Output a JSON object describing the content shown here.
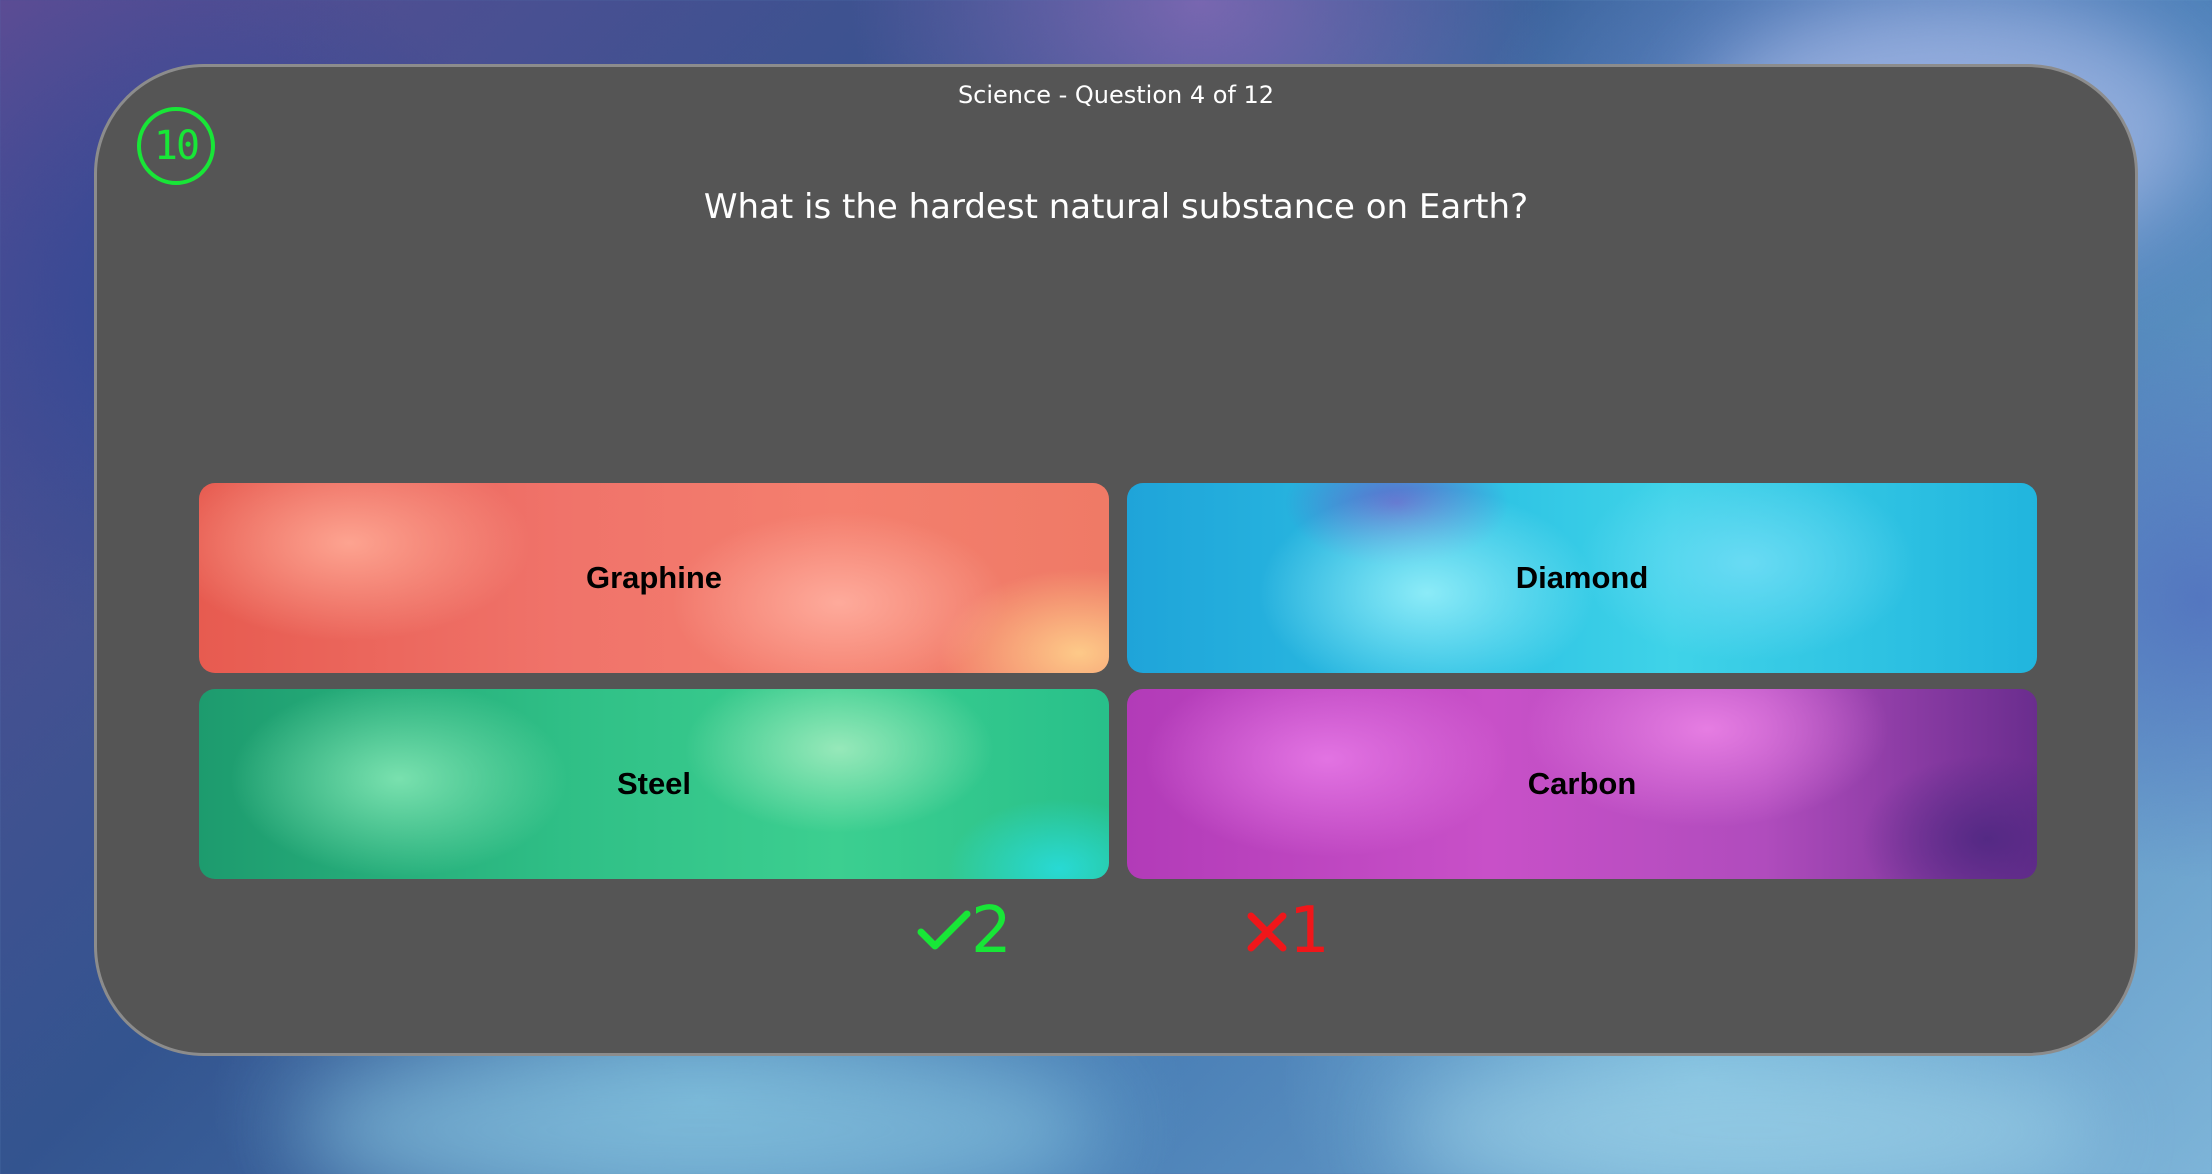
{
  "header": {
    "subtitle": "Science - Question 4 of 12"
  },
  "timer": {
    "value": "10",
    "color": "#18e637"
  },
  "question": {
    "text": "What is the hardest natural substance on Earth?"
  },
  "answers": [
    {
      "label": "Graphine",
      "color": "#f0736a"
    },
    {
      "label": "Diamond",
      "color": "#2ec3e4"
    },
    {
      "label": "Steel",
      "color": "#2fbf86"
    },
    {
      "label": "Carbon",
      "color": "#c850c8"
    }
  ],
  "score": {
    "correct_icon": "check-icon",
    "correct_count": "2",
    "correct_color": "#18e637",
    "wrong_icon": "cross-icon",
    "wrong_count": "1",
    "wrong_color": "#f0161a"
  },
  "theme": {
    "card_background": "#555555"
  }
}
